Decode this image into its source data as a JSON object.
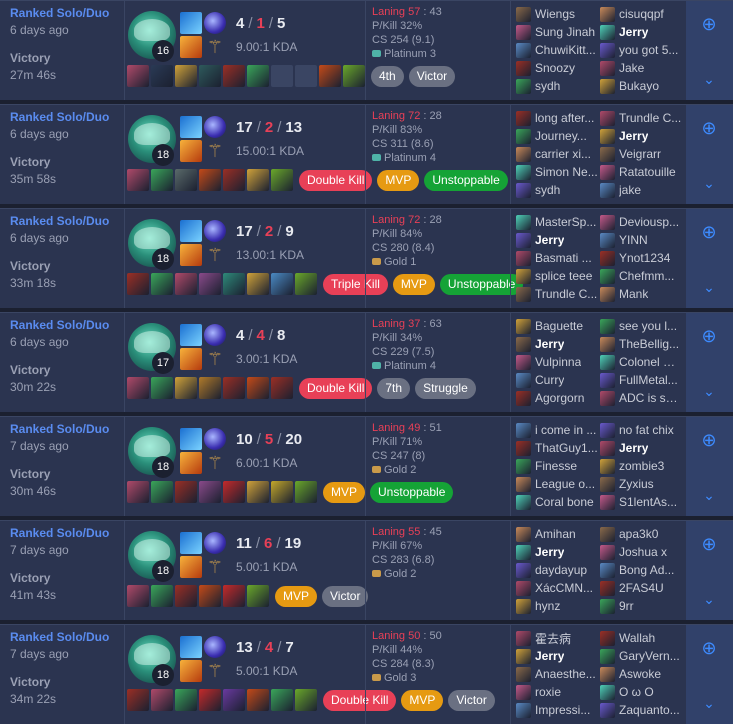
{
  "colors": {
    "win": "#5a8cf0",
    "death": "#e84057",
    "platinum": "#4fb3a8",
    "gold": "#c99a4a"
  },
  "matches": [
    {
      "queue": "Ranked Solo/Duo",
      "ago": "6 days ago",
      "result": "Victory",
      "duration": "27m 46s",
      "level": "16",
      "kills": "4",
      "deaths": "1",
      "assists": "5",
      "ratio": "9.00:1 KDA",
      "laning_label": "Laning 57",
      "laning_val": "43",
      "pkill": "P/Kill 32%",
      "cs": "CS 254 (9.1)",
      "rank": "Platinum 3",
      "rank_tier": "platinum",
      "items": [
        "#b04a6a",
        "#2a3a55",
        "#d0a23a",
        "#2e5a5c",
        "#9b2f25",
        "#3aa65a",
        "#3a4563",
        "#3a4563",
        "#c44a18",
        "#6aa82a"
      ],
      "badges": [
        {
          "label": "4th",
          "kind": "gray"
        },
        {
          "label": "Victor",
          "kind": "gray"
        }
      ],
      "team1": [
        "Wiengs",
        "Sung Jinah",
        "ChuwiKitt...",
        "Snoozy",
        "sydh"
      ],
      "team2": [
        "cisuqqpf",
        "Jerry",
        "you got 5...",
        "Jake",
        "Bukayo"
      ],
      "me_team": 2,
      "me_index": 1
    },
    {
      "queue": "Ranked Solo/Duo",
      "ago": "6 days ago",
      "result": "Victory",
      "duration": "35m 58s",
      "level": "18",
      "kills": "17",
      "deaths": "2",
      "assists": "13",
      "ratio": "15.00:1 KDA",
      "laning_label": "Laning 72",
      "laning_val": "28",
      "pkill": "P/Kill 83%",
      "cs": "CS 311 (8.6)",
      "rank": "Platinum 4",
      "rank_tier": "platinum",
      "items": [
        "#b04a6a",
        "#3aa65a",
        "#5a6a6a",
        "#c44a18",
        "#9b2f25",
        "#d0a23a",
        "#6aa82a"
      ],
      "badges": [
        {
          "label": "Double Kill",
          "kind": "red"
        },
        {
          "label": "MVP",
          "kind": "orange"
        },
        {
          "label": "Unstoppable",
          "kind": "green"
        }
      ],
      "team1": [
        "long after...",
        "Journey...",
        "carrier xi...",
        "Simon Ne...",
        "sydh"
      ],
      "team2": [
        "Trundle C...",
        "Jerry",
        "Veigrarr",
        "Ratatouille",
        "jake"
      ],
      "me_team": 2,
      "me_index": 1
    },
    {
      "queue": "Ranked Solo/Duo",
      "ago": "6 days ago",
      "result": "Victory",
      "duration": "33m 18s",
      "level": "18",
      "kills": "17",
      "deaths": "2",
      "assists": "9",
      "ratio": "13.00:1 KDA",
      "laning_label": "Laning 72",
      "laning_val": "28",
      "pkill": "P/Kill 84%",
      "cs": "CS 280 (8.4)",
      "rank": "Gold 1",
      "rank_tier": "gold",
      "items": [
        "#9b2f25",
        "#3aa65a",
        "#b04a6a",
        "#8a4a8a",
        "#2e8a7a",
        "#d0a23a",
        "#4a8ac4",
        "#6aa82a"
      ],
      "badges": [
        {
          "label": "Triple Kill",
          "kind": "red"
        },
        {
          "label": "MVP",
          "kind": "orange"
        },
        {
          "label": "Unstoppable",
          "kind": "green"
        }
      ],
      "team1": [
        "MasterSp...",
        "Jerry",
        "Basmati ...",
        "splice teee",
        "Trundle C..."
      ],
      "team2": [
        "Deviousp...",
        "YINN",
        "Ynot1234",
        "Chefmm...",
        "Mank"
      ],
      "me_team": 1,
      "me_index": 1
    },
    {
      "queue": "Ranked Solo/Duo",
      "ago": "6 days ago",
      "result": "Victory",
      "duration": "30m 22s",
      "level": "17",
      "kills": "4",
      "deaths": "4",
      "assists": "8",
      "ratio": "3.00:1 KDA",
      "laning_label": "Laning 37",
      "laning_val": "63",
      "pkill": "P/Kill 34%",
      "cs": "CS 229 (7.5)",
      "rank": "Platinum 4",
      "rank_tier": "platinum",
      "items": [
        "#b04a6a",
        "#3aa65a",
        "#d0a23a",
        "#b07a2a",
        "#9b2f25",
        "#c44a18",
        "#9b2f25"
      ],
      "badges": [
        {
          "label": "Double Kill",
          "kind": "red"
        },
        {
          "label": "7th",
          "kind": "gray"
        },
        {
          "label": "Struggle",
          "kind": "gray"
        }
      ],
      "team1": [
        "Baguette",
        "Jerry",
        "Vulpinna",
        "Curry",
        "Agorgorn"
      ],
      "team2": [
        "see you l...",
        "TheBellig...",
        "Colonel G...",
        "FullMetal...",
        "ADC is so..."
      ],
      "me_team": 1,
      "me_index": 1
    },
    {
      "queue": "Ranked Solo/Duo",
      "ago": "7 days ago",
      "result": "Victory",
      "duration": "30m 46s",
      "level": "18",
      "kills": "10",
      "deaths": "5",
      "assists": "20",
      "ratio": "6.00:1 KDA",
      "laning_label": "Laning 49",
      "laning_val": "51",
      "pkill": "P/Kill 71%",
      "cs": "CS 247 (8)",
      "rank": "Gold 2",
      "rank_tier": "gold",
      "items": [
        "#b04a6a",
        "#3aa65a",
        "#9b2f25",
        "#8a4a8a",
        "#c42a2a",
        "#d0a23a",
        "#c4a82a",
        "#6aa82a"
      ],
      "badges": [
        {
          "label": "MVP",
          "kind": "orange"
        },
        {
          "label": "Unstoppable",
          "kind": "green"
        }
      ],
      "team1": [
        "i come in ...",
        "ThatGuy1...",
        "Finesse",
        "League o...",
        "Coral bone"
      ],
      "team2": [
        "no fat chix",
        "Jerry",
        "zombie3",
        "Zyxius",
        "S1lentAs..."
      ],
      "me_team": 2,
      "me_index": 1
    },
    {
      "queue": "Ranked Solo/Duo",
      "ago": "7 days ago",
      "result": "Victory",
      "duration": "41m 43s",
      "level": "18",
      "kills": "11",
      "deaths": "6",
      "assists": "19",
      "ratio": "5.00:1 KDA",
      "laning_label": "Laning 55",
      "laning_val": "45",
      "pkill": "P/Kill 67%",
      "cs": "CS 283 (6.8)",
      "rank": "Gold 2",
      "rank_tier": "gold",
      "items": [
        "#b04a6a",
        "#3aa65a",
        "#9b2f25",
        "#c44a18",
        "#c42a2a",
        "#6aa82a"
      ],
      "badges": [
        {
          "label": "MVP",
          "kind": "orange"
        },
        {
          "label": "Victor",
          "kind": "gray"
        }
      ],
      "team1": [
        "Amihan",
        "Jerry",
        "daydayup",
        "XácCMN...",
        "hynz"
      ],
      "team2": [
        "apa3k0",
        "Joshua x",
        "Bong Ad...",
        "2FAS4U",
        "9rr"
      ],
      "me_team": 1,
      "me_index": 1
    },
    {
      "queue": "Ranked Solo/Duo",
      "ago": "7 days ago",
      "result": "Victory",
      "duration": "34m 22s",
      "level": "18",
      "kills": "13",
      "deaths": "4",
      "assists": "7",
      "ratio": "5.00:1 KDA",
      "laning_label": "Laning 50",
      "laning_val": "50",
      "pkill": "P/Kill 44%",
      "cs": "CS 284 (8.3)",
      "rank": "Gold 3",
      "rank_tier": "gold",
      "items": [
        "#9b2f25",
        "#b04a6a",
        "#3aa65a",
        "#c42a2a",
        "#6a3aa0",
        "#c44a18",
        "#3aa65a",
        "#6aa82a"
      ],
      "badges": [
        {
          "label": "Double Kill",
          "kind": "red"
        },
        {
          "label": "MVP",
          "kind": "orange"
        },
        {
          "label": "Victor",
          "kind": "gray"
        }
      ],
      "team1": [
        "霍去病",
        "Jerry",
        "Anaesthe...",
        "roxie",
        "Impressi..."
      ],
      "team2": [
        "Wallah",
        "GaryVern...",
        "Aswoke",
        "O ω O",
        "Zaquanto..."
      ],
      "me_team": 1,
      "me_index": 1
    }
  ],
  "portrait_colors": [
    "#c98a5a",
    "#4fd1b8",
    "#6a5acd",
    "#b04a6a",
    "#d0a23a",
    "#8a6a4a",
    "#c45a8a",
    "#5a8ac4",
    "#9b2f25",
    "#3aa65a"
  ],
  "icons": {
    "add": "add-friend-icon",
    "expand": "chevron-down-icon"
  }
}
